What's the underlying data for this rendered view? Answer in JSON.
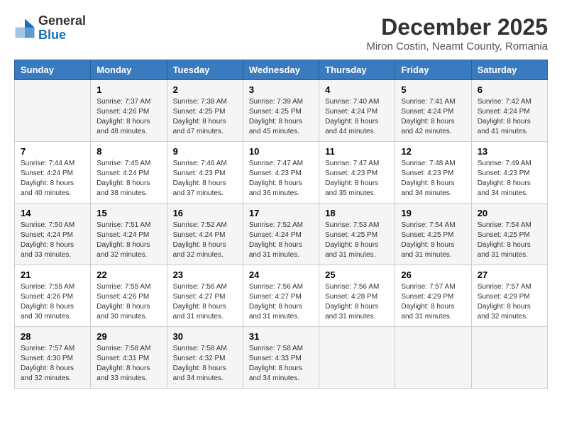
{
  "header": {
    "logo_general": "General",
    "logo_blue": "Blue",
    "month_title": "December 2025",
    "location": "Miron Costin, Neamt County, Romania"
  },
  "calendar": {
    "days_of_week": [
      "Sunday",
      "Monday",
      "Tuesday",
      "Wednesday",
      "Thursday",
      "Friday",
      "Saturday"
    ],
    "weeks": [
      [
        {
          "day": "",
          "info": ""
        },
        {
          "day": "1",
          "info": "Sunrise: 7:37 AM\nSunset: 4:26 PM\nDaylight: 8 hours\nand 48 minutes."
        },
        {
          "day": "2",
          "info": "Sunrise: 7:38 AM\nSunset: 4:25 PM\nDaylight: 8 hours\nand 47 minutes."
        },
        {
          "day": "3",
          "info": "Sunrise: 7:39 AM\nSunset: 4:25 PM\nDaylight: 8 hours\nand 45 minutes."
        },
        {
          "day": "4",
          "info": "Sunrise: 7:40 AM\nSunset: 4:24 PM\nDaylight: 8 hours\nand 44 minutes."
        },
        {
          "day": "5",
          "info": "Sunrise: 7:41 AM\nSunset: 4:24 PM\nDaylight: 8 hours\nand 42 minutes."
        },
        {
          "day": "6",
          "info": "Sunrise: 7:42 AM\nSunset: 4:24 PM\nDaylight: 8 hours\nand 41 minutes."
        }
      ],
      [
        {
          "day": "7",
          "info": "Sunrise: 7:44 AM\nSunset: 4:24 PM\nDaylight: 8 hours\nand 40 minutes."
        },
        {
          "day": "8",
          "info": "Sunrise: 7:45 AM\nSunset: 4:24 PM\nDaylight: 8 hours\nand 38 minutes."
        },
        {
          "day": "9",
          "info": "Sunrise: 7:46 AM\nSunset: 4:23 PM\nDaylight: 8 hours\nand 37 minutes."
        },
        {
          "day": "10",
          "info": "Sunrise: 7:47 AM\nSunset: 4:23 PM\nDaylight: 8 hours\nand 36 minutes."
        },
        {
          "day": "11",
          "info": "Sunrise: 7:47 AM\nSunset: 4:23 PM\nDaylight: 8 hours\nand 35 minutes."
        },
        {
          "day": "12",
          "info": "Sunrise: 7:48 AM\nSunset: 4:23 PM\nDaylight: 8 hours\nand 34 minutes."
        },
        {
          "day": "13",
          "info": "Sunrise: 7:49 AM\nSunset: 4:23 PM\nDaylight: 8 hours\nand 34 minutes."
        }
      ],
      [
        {
          "day": "14",
          "info": "Sunrise: 7:50 AM\nSunset: 4:24 PM\nDaylight: 8 hours\nand 33 minutes."
        },
        {
          "day": "15",
          "info": "Sunrise: 7:51 AM\nSunset: 4:24 PM\nDaylight: 8 hours\nand 32 minutes."
        },
        {
          "day": "16",
          "info": "Sunrise: 7:52 AM\nSunset: 4:24 PM\nDaylight: 8 hours\nand 32 minutes."
        },
        {
          "day": "17",
          "info": "Sunrise: 7:52 AM\nSunset: 4:24 PM\nDaylight: 8 hours\nand 31 minutes."
        },
        {
          "day": "18",
          "info": "Sunrise: 7:53 AM\nSunset: 4:25 PM\nDaylight: 8 hours\nand 31 minutes."
        },
        {
          "day": "19",
          "info": "Sunrise: 7:54 AM\nSunset: 4:25 PM\nDaylight: 8 hours\nand 31 minutes."
        },
        {
          "day": "20",
          "info": "Sunrise: 7:54 AM\nSunset: 4:25 PM\nDaylight: 8 hours\nand 31 minutes."
        }
      ],
      [
        {
          "day": "21",
          "info": "Sunrise: 7:55 AM\nSunset: 4:26 PM\nDaylight: 8 hours\nand 30 minutes."
        },
        {
          "day": "22",
          "info": "Sunrise: 7:55 AM\nSunset: 4:26 PM\nDaylight: 8 hours\nand 30 minutes."
        },
        {
          "day": "23",
          "info": "Sunrise: 7:56 AM\nSunset: 4:27 PM\nDaylight: 8 hours\nand 31 minutes."
        },
        {
          "day": "24",
          "info": "Sunrise: 7:56 AM\nSunset: 4:27 PM\nDaylight: 8 hours\nand 31 minutes."
        },
        {
          "day": "25",
          "info": "Sunrise: 7:56 AM\nSunset: 4:28 PM\nDaylight: 8 hours\nand 31 minutes."
        },
        {
          "day": "26",
          "info": "Sunrise: 7:57 AM\nSunset: 4:29 PM\nDaylight: 8 hours\nand 31 minutes."
        },
        {
          "day": "27",
          "info": "Sunrise: 7:57 AM\nSunset: 4:29 PM\nDaylight: 8 hours\nand 32 minutes."
        }
      ],
      [
        {
          "day": "28",
          "info": "Sunrise: 7:57 AM\nSunset: 4:30 PM\nDaylight: 8 hours\nand 32 minutes."
        },
        {
          "day": "29",
          "info": "Sunrise: 7:58 AM\nSunset: 4:31 PM\nDaylight: 8 hours\nand 33 minutes."
        },
        {
          "day": "30",
          "info": "Sunrise: 7:58 AM\nSunset: 4:32 PM\nDaylight: 8 hours\nand 34 minutes."
        },
        {
          "day": "31",
          "info": "Sunrise: 7:58 AM\nSunset: 4:33 PM\nDaylight: 8 hours\nand 34 minutes."
        },
        {
          "day": "",
          "info": ""
        },
        {
          "day": "",
          "info": ""
        },
        {
          "day": "",
          "info": ""
        }
      ]
    ]
  }
}
